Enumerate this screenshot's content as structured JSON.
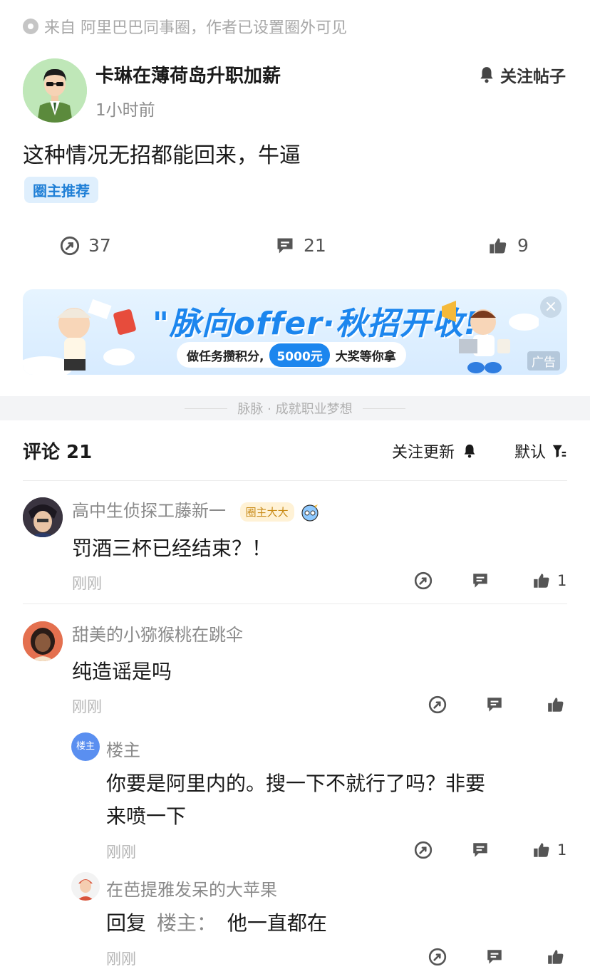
{
  "source": {
    "text": "来自 阿里巴巴同事圈，作者已设置圈外可见"
  },
  "post": {
    "author": "卡琳在薄荷岛升职加薪",
    "time": "1小时前",
    "follow_label": "关注帖子",
    "content": "这种情况无招都能回来，牛逼",
    "tag": "圈主推荐",
    "stats": {
      "share": "37",
      "comment": "21",
      "like": "9"
    }
  },
  "banner": {
    "title": "\"脉向offer·秋招开收!!",
    "subtitle_prefix": "做任务攒积分,",
    "subtitle_money": "5000元",
    "subtitle_suffix": "大奖等你拿",
    "ad_label": "广告"
  },
  "divider": {
    "text": "脉脉 · 成就职业梦想"
  },
  "comments_header": {
    "title": "评论 21",
    "follow_updates": "关注更新",
    "sort": "默认"
  },
  "comments": [
    {
      "name": "高中生侦探工藤新一",
      "badge": "圈主大大",
      "text": "罚酒三杯已经结束？！",
      "time": "刚刚",
      "likes": "1"
    },
    {
      "name": "甜美的小猕猴桃在跳伞",
      "text": "纯造谣是吗",
      "time": "刚刚",
      "likes": ""
    }
  ],
  "replies": [
    {
      "avatar_label": "楼主",
      "name": "楼主",
      "text_line1": "你要是阿里内的。搜一下不就行了吗？非要",
      "text_line2": "来喷一下",
      "time": "刚刚",
      "likes": "1"
    },
    {
      "name": "在芭提雅发呆的大苹果",
      "reply_prefix": "回复",
      "reply_to": "楼主：",
      "text": "他一直都在",
      "time": "刚刚",
      "likes": ""
    }
  ],
  "colors": {
    "accent": "#1f7fd6",
    "muted": "#8c8c8c"
  }
}
